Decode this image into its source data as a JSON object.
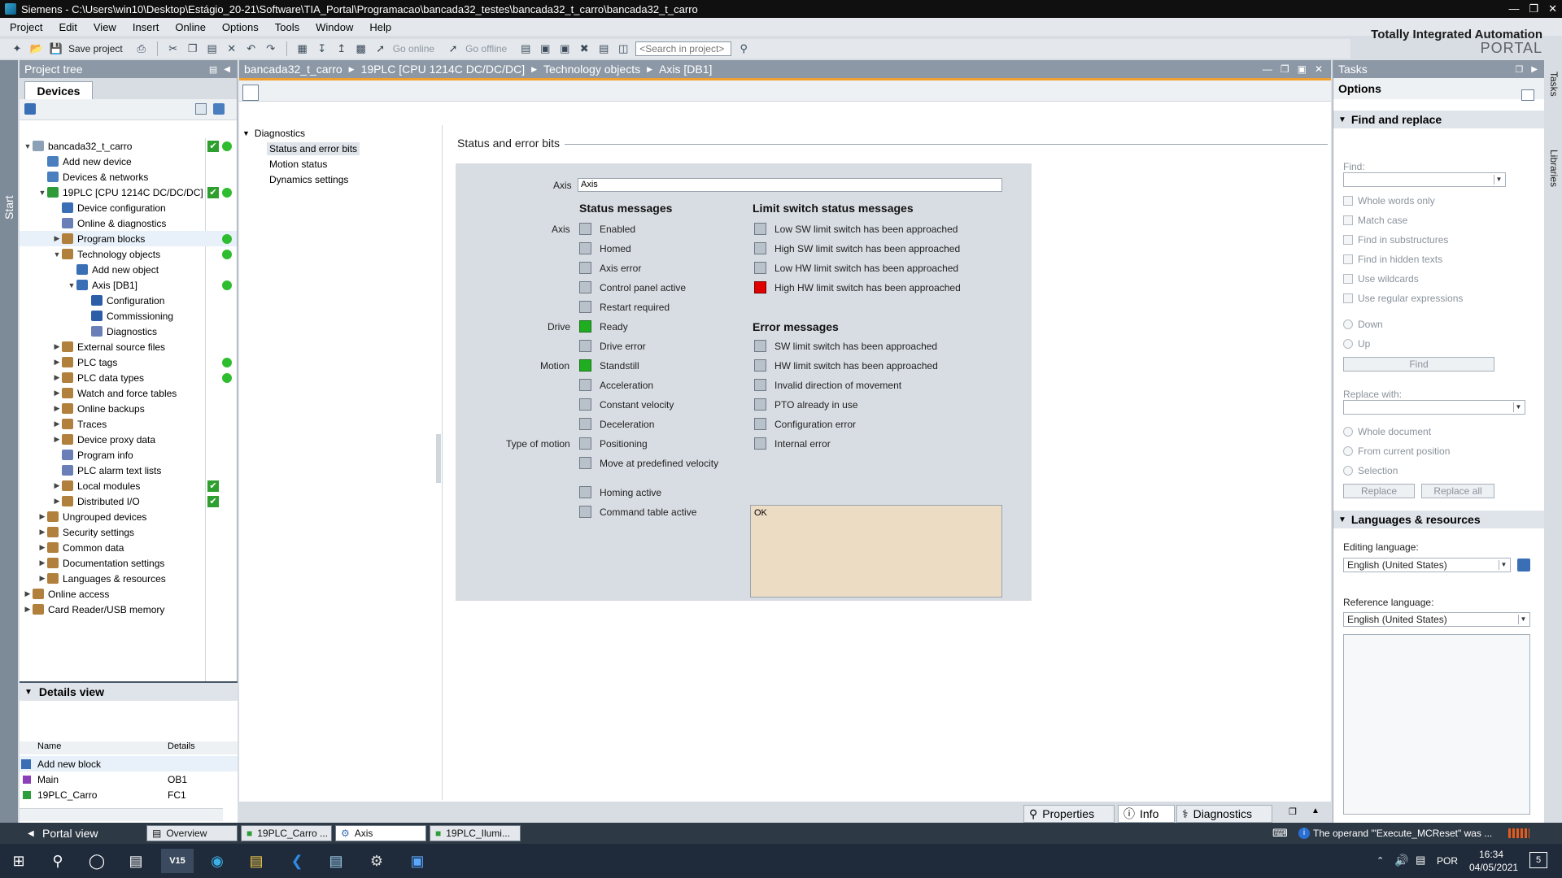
{
  "titlebar": {
    "text": "Siemens  -  C:\\Users\\win10\\Desktop\\Estágio_20-21\\Software\\TIA_Portal\\Programacao\\bancada32_testes\\bancada32_t_carro\\bancada32_t_carro"
  },
  "menu": [
    "Project",
    "Edit",
    "View",
    "Insert",
    "Online",
    "Options",
    "Tools",
    "Window",
    "Help"
  ],
  "brand": {
    "line1": "Totally Integrated Automation",
    "line2": "PORTAL"
  },
  "toolbar": {
    "save": "Save project",
    "go_online": "Go online",
    "go_offline": "Go offline",
    "search_placeholder": "<Search in project>"
  },
  "start_tab": "Start",
  "project_tree": {
    "title": "Project tree",
    "tab": "Devices",
    "items": [
      {
        "label": "bancada32_t_carro",
        "level": 0,
        "exp": "▼",
        "check": true,
        "dot": true,
        "color": "#8ca0b6"
      },
      {
        "label": "Add new device",
        "level": 1,
        "exp": "",
        "color": "#4a7fbf"
      },
      {
        "label": "Devices & networks",
        "level": 1,
        "exp": "",
        "color": "#4a7fbf"
      },
      {
        "label": "19PLC [CPU 1214C DC/DC/DC]",
        "level": 1,
        "exp": "▼",
        "check": true,
        "dot": true,
        "color": "#2f9a3a"
      },
      {
        "label": "Device configuration",
        "level": 2,
        "exp": "",
        "color": "#3a6fb5"
      },
      {
        "label": "Online & diagnostics",
        "level": 2,
        "exp": "",
        "color": "#6a7fb8"
      },
      {
        "label": "Program blocks",
        "level": 2,
        "exp": "▶",
        "dot": true,
        "sel": true,
        "color": "#b0803c"
      },
      {
        "label": "Technology objects",
        "level": 2,
        "exp": "▼",
        "dot": true,
        "color": "#b0803c"
      },
      {
        "label": "Add new object",
        "level": 3,
        "exp": "",
        "color": "#3a6fb5"
      },
      {
        "label": "Axis [DB1]",
        "level": 3,
        "exp": "▼",
        "dot": true,
        "color": "#3a6fb5"
      },
      {
        "label": "Configuration",
        "level": 4,
        "exp": "",
        "color": "#2c5ea8"
      },
      {
        "label": "Commissioning",
        "level": 4,
        "exp": "",
        "color": "#2c5ea8"
      },
      {
        "label": "Diagnostics",
        "level": 4,
        "exp": "",
        "color": "#6a7fb8"
      },
      {
        "label": "External source files",
        "level": 2,
        "exp": "▶",
        "color": "#b0803c"
      },
      {
        "label": "PLC tags",
        "level": 2,
        "exp": "▶",
        "dot": true,
        "color": "#b0803c"
      },
      {
        "label": "PLC data types",
        "level": 2,
        "exp": "▶",
        "dot": true,
        "color": "#b0803c"
      },
      {
        "label": "Watch and force tables",
        "level": 2,
        "exp": "▶",
        "color": "#b0803c"
      },
      {
        "label": "Online backups",
        "level": 2,
        "exp": "▶",
        "color": "#b0803c"
      },
      {
        "label": "Traces",
        "level": 2,
        "exp": "▶",
        "color": "#b0803c"
      },
      {
        "label": "Device proxy data",
        "level": 2,
        "exp": "▶",
        "color": "#b0803c"
      },
      {
        "label": "Program info",
        "level": 2,
        "exp": "",
        "color": "#6a7fb8"
      },
      {
        "label": "PLC alarm text lists",
        "level": 2,
        "exp": "",
        "color": "#6a7fb8"
      },
      {
        "label": "Local modules",
        "level": 2,
        "exp": "▶",
        "check": true,
        "color": "#b0803c"
      },
      {
        "label": "Distributed I/O",
        "level": 2,
        "exp": "▶",
        "check": true,
        "color": "#b0803c"
      },
      {
        "label": "Ungrouped devices",
        "level": 1,
        "exp": "▶",
        "color": "#b0803c"
      },
      {
        "label": "Security settings",
        "level": 1,
        "exp": "▶",
        "color": "#b0803c"
      },
      {
        "label": "Common data",
        "level": 1,
        "exp": "▶",
        "color": "#b0803c"
      },
      {
        "label": "Documentation settings",
        "level": 1,
        "exp": "▶",
        "color": "#b0803c"
      },
      {
        "label": "Languages & resources",
        "level": 1,
        "exp": "▶",
        "color": "#b0803c"
      },
      {
        "label": "Online access",
        "level": 0,
        "exp": "▶",
        "color": "#b0803c"
      },
      {
        "label": "Card Reader/USB memory",
        "level": 0,
        "exp": "▶",
        "color": "#b0803c"
      }
    ]
  },
  "details_view": {
    "title": "Details view",
    "col_name": "Name",
    "col_details": "Details",
    "rows": [
      {
        "name": "Add new block",
        "details": ""
      },
      {
        "name": "Main",
        "details": "OB1"
      },
      {
        "name": "19PLC_Carro",
        "details": "FC1"
      }
    ]
  },
  "editor": {
    "breadcrumb": [
      "bancada32_t_carro",
      "19PLC [CPU 1214C DC/DC/DC]",
      "Technology objects",
      "Axis [DB1]"
    ],
    "nav": {
      "group": "Diagnostics",
      "items": [
        "Status and error bits",
        "Motion status",
        "Dynamics settings"
      ]
    },
    "section_title": "Status and error bits",
    "axis_label": "Axis",
    "axis_value": "Axis",
    "status_heading": "Status messages",
    "limit_heading": "Limit switch status messages",
    "error_heading": "Error messages",
    "group_labels": {
      "axis": "Axis",
      "drive": "Drive",
      "motion": "Motion",
      "type": "Type of motion"
    },
    "status": [
      {
        "label": "Enabled",
        "state": "off"
      },
      {
        "label": "Homed",
        "state": "off"
      },
      {
        "label": "Axis error",
        "state": "off"
      },
      {
        "label": "Control panel active",
        "state": "off"
      },
      {
        "label": "Restart required",
        "state": "off"
      },
      {
        "label": "Ready",
        "state": "green"
      },
      {
        "label": "Drive error",
        "state": "off"
      },
      {
        "label": "Standstill",
        "state": "green"
      },
      {
        "label": "Acceleration",
        "state": "off"
      },
      {
        "label": "Constant velocity",
        "state": "off"
      },
      {
        "label": "Deceleration",
        "state": "off"
      },
      {
        "label": "Positioning",
        "state": "off"
      },
      {
        "label": "Move at predefined velocity",
        "state": "off"
      },
      {
        "label": "Homing active",
        "state": "off"
      },
      {
        "label": "Command table active",
        "state": "off"
      }
    ],
    "limit": [
      {
        "label": "Low SW limit switch has been approached",
        "state": "off"
      },
      {
        "label": "High SW limit switch has been approached",
        "state": "off"
      },
      {
        "label": "Low HW limit switch has been approached",
        "state": "off"
      },
      {
        "label": "High HW limit switch has been approached",
        "state": "red"
      }
    ],
    "errors": [
      {
        "label": "SW limit switch has been approached",
        "state": "off"
      },
      {
        "label": "HW limit switch has been approached",
        "state": "off"
      },
      {
        "label": "Invalid direction of movement",
        "state": "off"
      },
      {
        "label": "PTO already in use",
        "state": "off"
      },
      {
        "label": "Configuration error",
        "state": "off"
      },
      {
        "label": "Internal error",
        "state": "off"
      }
    ],
    "message": "OK",
    "bottom_tabs": {
      "properties": "Properties",
      "info": "Info",
      "diagnostics": "Diagnostics"
    }
  },
  "tasks": {
    "title": "Tasks",
    "options": "Options",
    "find_replace": "Find and replace",
    "find_label": "Find:",
    "checks": [
      "Whole words only",
      "Match case",
      "Find in substructures",
      "Find in hidden texts",
      "Use wildcards",
      "Use regular expressions"
    ],
    "dir": [
      "Down",
      "Up"
    ],
    "find_btn": "Find",
    "replace_label": "Replace with:",
    "scope": [
      "Whole document",
      "From current position",
      "Selection"
    ],
    "replace_btn": "Replace",
    "replace_all_btn": "Replace all",
    "lang_title": "Languages & resources",
    "editing_label": "Editing language:",
    "editing_value": "English (United States)",
    "reference_label": "Reference language:",
    "reference_value": "English (United States)",
    "side_tabs": [
      "Tasks",
      "Libraries"
    ]
  },
  "statusbar": {
    "portal_view": "Portal view",
    "tabs": [
      "Overview",
      "19PLC_Carro ...",
      "Axis",
      "19PLC_Ilumi..."
    ],
    "message": "The operand '\"Execute_MCReset\" was ..."
  },
  "taskbar": {
    "lang": "POR",
    "time": "16:34",
    "date": "04/05/2021",
    "notif": "5"
  }
}
